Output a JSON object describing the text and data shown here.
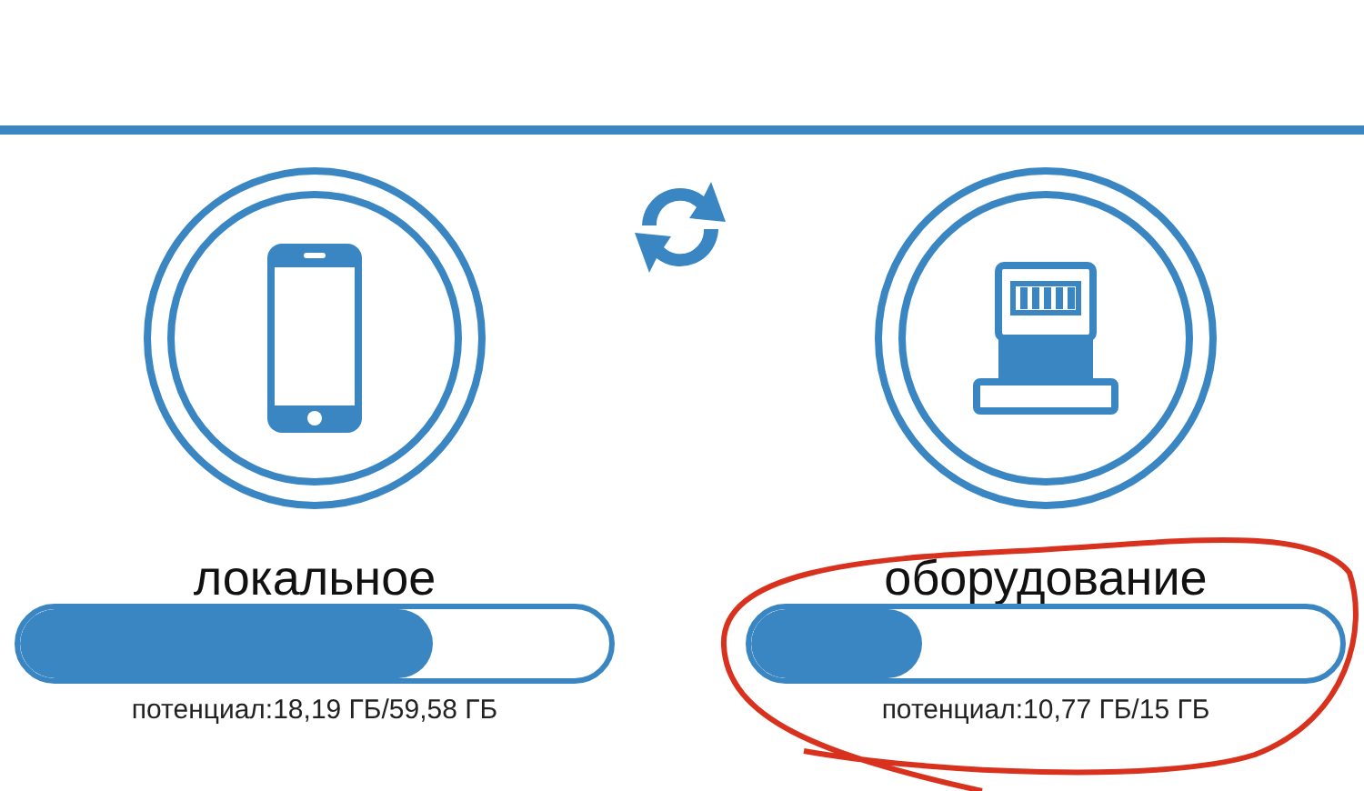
{
  "storages": [
    {
      "kind": "phone",
      "label": "локальное",
      "level": 0.7,
      "caption": "потенциал:18,19 ГБ/59,58 ГБ"
    },
    {
      "kind": "connector",
      "label": "оборудование",
      "level": 0.29,
      "caption": "потенциал:10,77 ГБ/15 ГБ"
    }
  ]
}
